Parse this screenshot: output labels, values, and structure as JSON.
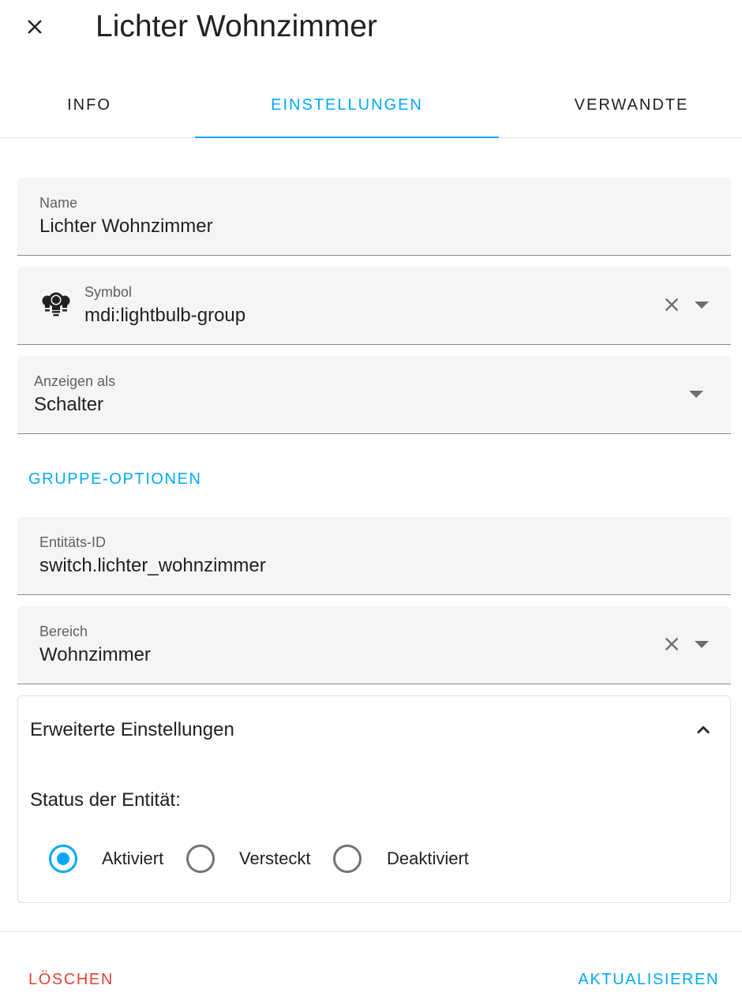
{
  "dialog": {
    "title": "Lichter Wohnzimmer",
    "close_icon": "close-icon"
  },
  "tabs": [
    {
      "label": "INFO",
      "active": false
    },
    {
      "label": "EINSTELLUNGEN",
      "active": true
    },
    {
      "label": "VERWANDTE",
      "active": false
    }
  ],
  "fields": {
    "name": {
      "label": "Name",
      "value": "Lichter Wohnzimmer"
    },
    "symbol": {
      "label": "Symbol",
      "value": "mdi:lightbulb-group",
      "icon": "lightbulb-group-icon"
    },
    "display_as": {
      "label": "Anzeigen als",
      "value": "Schalter"
    },
    "entity_id": {
      "label": "Entitäts-ID",
      "value": "switch.lichter_wohnzimmer"
    },
    "area": {
      "label": "Bereich",
      "value": "Wohnzimmer"
    }
  },
  "group_options_label": "GRUPPE-OPTIONEN",
  "advanced": {
    "title": "Erweiterte Einstellungen",
    "expanded": true,
    "status_label": "Status der Entität:",
    "options": [
      {
        "label": "Aktiviert",
        "checked": true
      },
      {
        "label": "Versteckt",
        "checked": false
      },
      {
        "label": "Deaktiviert",
        "checked": false
      }
    ]
  },
  "footer": {
    "delete_label": "LÖSCHEN",
    "update_label": "AKTUALISIEREN"
  },
  "colors": {
    "accent": "#03a9f4",
    "danger": "#db4437",
    "field_bg": "#f5f5f5",
    "text": "#212121"
  }
}
